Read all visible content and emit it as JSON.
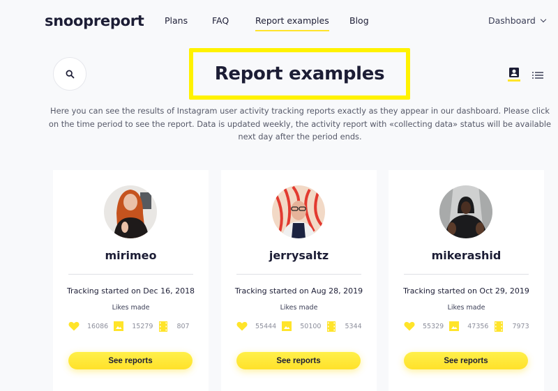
{
  "header": {
    "logo": "snoopreport",
    "nav": [
      {
        "label": "Plans",
        "active": false
      },
      {
        "label": "FAQ",
        "active": false
      },
      {
        "label": "Report examples",
        "active": true
      },
      {
        "label": "Blog",
        "active": false
      }
    ],
    "account_menu": "Dashboard"
  },
  "page": {
    "title": "Report examples",
    "search_icon": "search-icon",
    "view_modes": [
      {
        "icon": "profile-card-icon",
        "active": true
      },
      {
        "icon": "list-icon",
        "active": false
      }
    ],
    "description": "Here you can see the results of Instagram user activity tracking reports exactly as they appear in our dashboard. Please click on the time period to see the report. Data is updated weekly, the activity report with «collecting data» status will be available next day after the period ends."
  },
  "colors": {
    "accent": "#ffe42a",
    "highlight_frame": "#fff200",
    "text_dark": "#1c1d35",
    "background": "#f8f9fb"
  },
  "cards": [
    {
      "username": "mirimeo",
      "tracking": "Tracking started on Dec 16, 2018",
      "likes_label": "Likes made",
      "stats": {
        "hearts": "16086",
        "photos": "15279",
        "videos": "807"
      },
      "button": "See reports"
    },
    {
      "username": "jerrysaltz",
      "tracking": "Tracking started on Aug 28, 2019",
      "likes_label": "Likes made",
      "stats": {
        "hearts": "55444",
        "photos": "50100",
        "videos": "5344"
      },
      "button": "See reports"
    },
    {
      "username": "mikerashid",
      "tracking": "Tracking started on Oct 29, 2019",
      "likes_label": "Likes made",
      "stats": {
        "hearts": "55329",
        "photos": "47356",
        "videos": "7973"
      },
      "button": "See reports"
    }
  ]
}
